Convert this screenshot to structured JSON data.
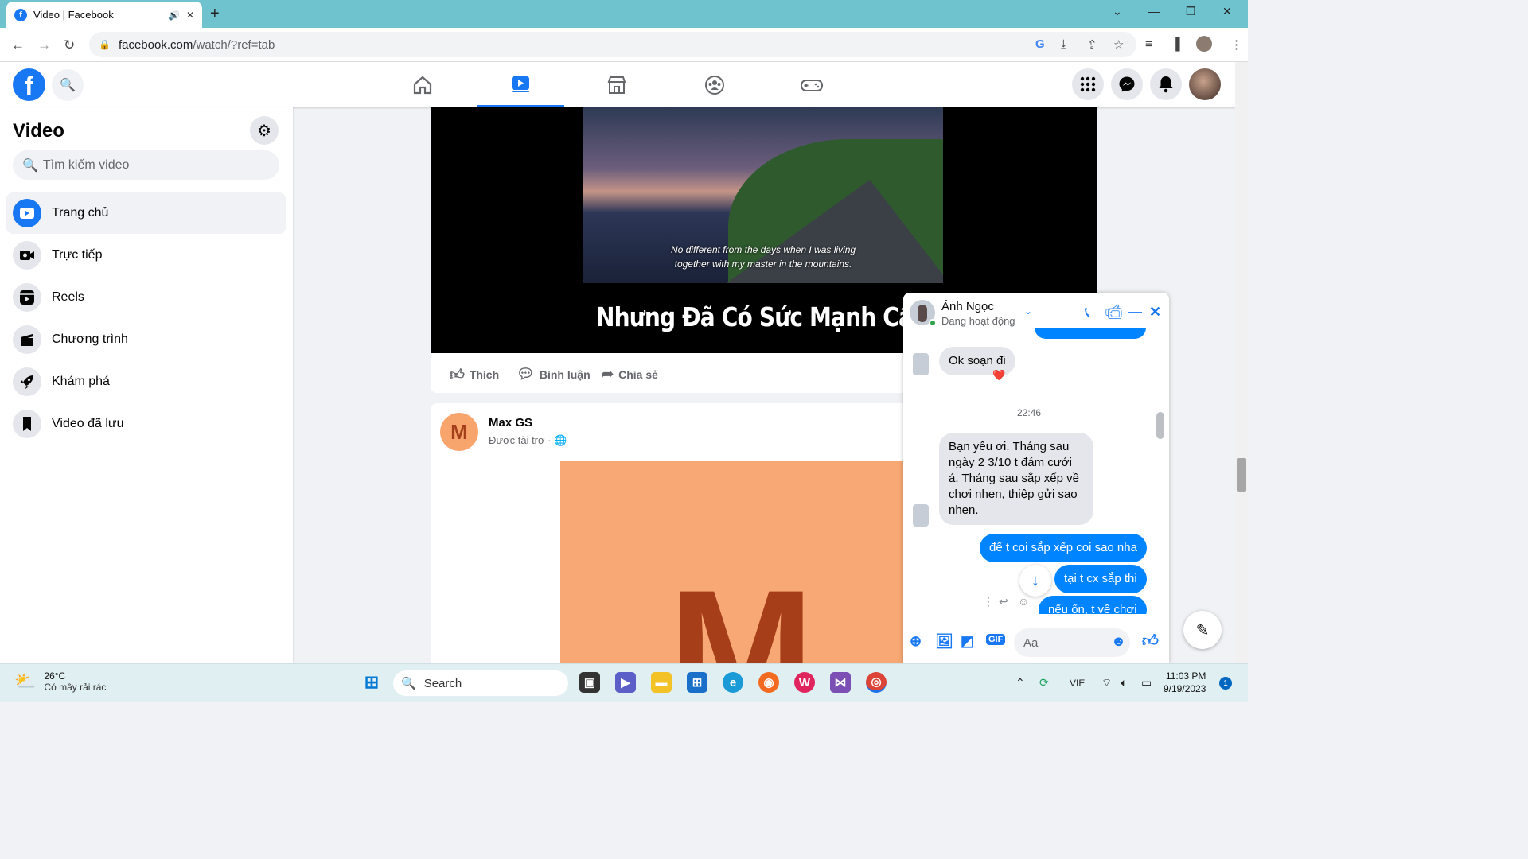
{
  "browser": {
    "tab_title": "Video | Facebook",
    "url_host": "facebook.com",
    "url_path": "/watch/?ref=tab"
  },
  "sidebar": {
    "title": "Video",
    "search_placeholder": "Tìm kiếm video",
    "items": [
      {
        "label": "Trang chủ",
        "icon": "play-icon",
        "active": true
      },
      {
        "label": "Trực tiếp",
        "icon": "live-icon"
      },
      {
        "label": "Reels",
        "icon": "reels-icon"
      },
      {
        "label": "Chương trình",
        "icon": "clapper-icon"
      },
      {
        "label": "Khám phá",
        "icon": "rocket-icon"
      },
      {
        "label": "Video đã lưu",
        "icon": "bookmark-icon"
      }
    ]
  },
  "video": {
    "subtitle_line1": "No different from the days when I was living",
    "subtitle_line2": "together with my master in the mountains.",
    "caption": "Nhưng Đã Có Sức Mạnh Cấp"
  },
  "actions": {
    "like": "Thích",
    "comment": "Bình luận",
    "share": "Chia sẻ"
  },
  "post": {
    "avatar_letter": "M",
    "author": "Max GS",
    "sub": "Được tài trợ · 🌐",
    "image_letter": "M"
  },
  "chat": {
    "name": "Ánh Ngọc",
    "status": "Đang hoạt động",
    "messages": [
      {
        "from": "them",
        "text": "Ok soạn đi",
        "reaction": "❤️"
      },
      {
        "from": "them",
        "text": "Bạn yêu ơi. Tháng sau ngày 2 3/10 t đám cưới á. Tháng sau sắp xếp về chơi nhen, thiệp gửi sao nhen."
      },
      {
        "from": "me",
        "text": "để t coi sắp xếp coi sao nha"
      },
      {
        "from": "me",
        "text": "tại t cx sắp thi"
      },
      {
        "from": "me",
        "text": "nếu ổn, t về chơi"
      }
    ],
    "time": "22:46",
    "input_placeholder": "Aa",
    "gif_label": "GIF"
  },
  "taskbar": {
    "temp": "26°C",
    "weather": "Có mây rải rác",
    "search": "Search",
    "lang": "VIE",
    "time": "11:03 PM",
    "date": "9/19/2023",
    "notif_count": "1"
  },
  "colors": {
    "fb_blue": "#1877f2",
    "messenger_blue": "#0084ff",
    "tab_bar": "#6fc3cf"
  }
}
